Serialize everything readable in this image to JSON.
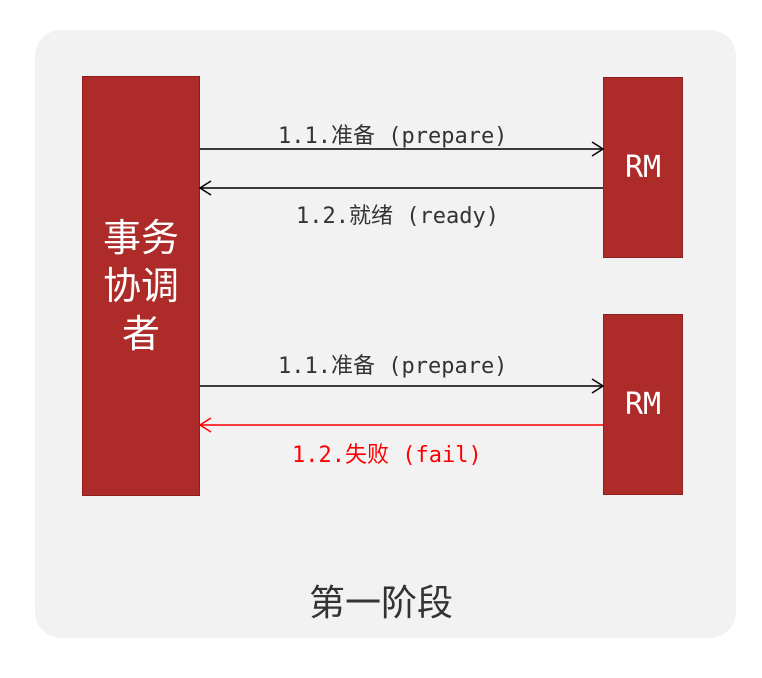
{
  "coordinator": {
    "label": "事务协调者"
  },
  "participants": [
    {
      "label": "RM"
    },
    {
      "label": "RM"
    }
  ],
  "messages": [
    {
      "text": "1.1.准备 (prepare)",
      "direction": "coordinator-to-rm",
      "status": "normal"
    },
    {
      "text": "1.2.就绪 (ready)",
      "direction": "rm-to-coordinator",
      "status": "normal"
    },
    {
      "text": "1.1.准备 (prepare)",
      "direction": "coordinator-to-rm",
      "status": "normal"
    },
    {
      "text": "1.2.失败 (fail)",
      "direction": "rm-to-coordinator",
      "status": "fail"
    }
  ],
  "phase_label": "第一阶段",
  "colors": {
    "box": "#ad2b29",
    "fail": "#ff0000",
    "arrow": "#000000",
    "panel": "#f2f2f2"
  }
}
